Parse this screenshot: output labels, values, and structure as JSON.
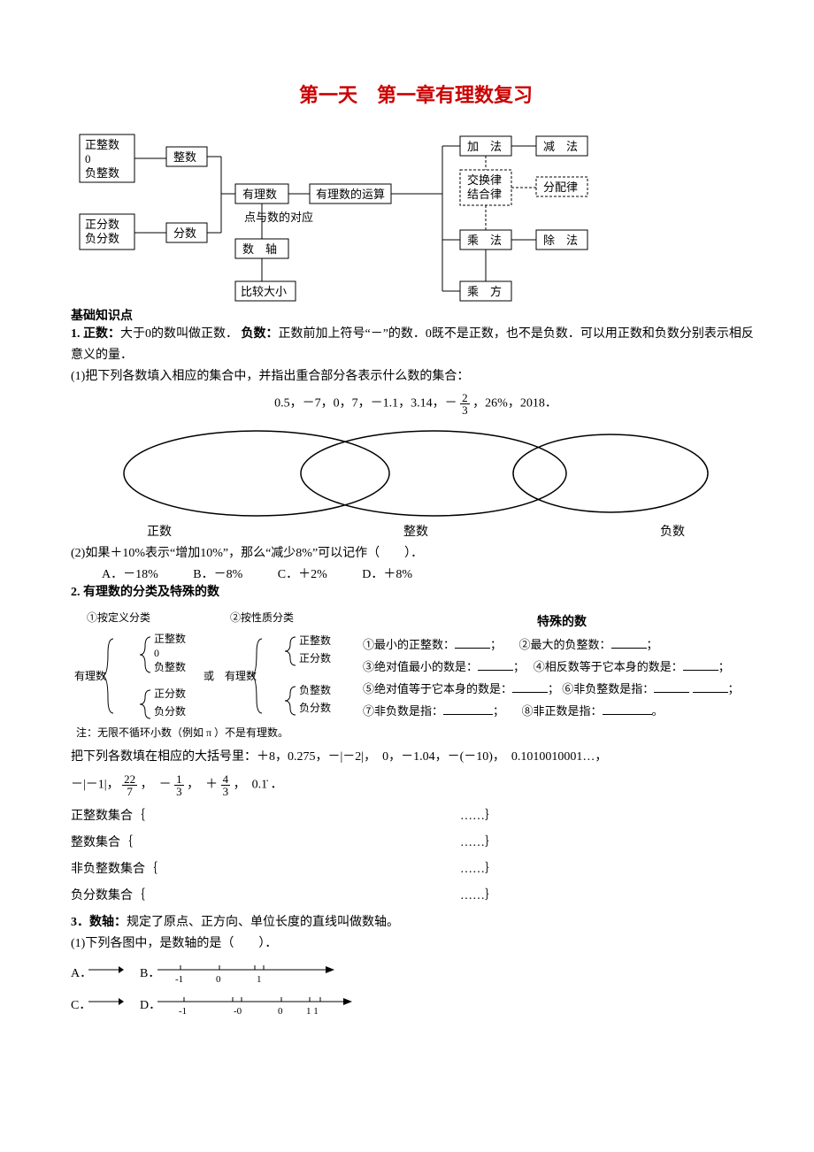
{
  "title": "第一天　第一章有理数复习",
  "diagram": {
    "left": {
      "box1": "正整数\n0\n负整数",
      "box2": "整数",
      "box3": "正分数\n负分数",
      "box4": "分数",
      "box5": "有理数",
      "box6": "有理数的运算",
      "box7": "点与数的对应",
      "box8": "数　轴",
      "box9": "比较大小"
    },
    "right": {
      "add": "加　法",
      "sub": "减　法",
      "laws1": "交换律\n结合律",
      "laws2": "分配律",
      "mul": "乘　法",
      "div": "除　法",
      "pow": "乘　方"
    }
  },
  "section_heading": "基础知识点",
  "p1_bold_a": "1. 正数：",
  "p1_text_a": "大于0的数叫做正数．",
  "p1_bold_b": "负数：",
  "p1_text_b": "正数前加上符号“－”的数．0既不是正数，也不是负数．可以用正数和负数分别表示相反意义的量．",
  "q1": "(1)把下列各数填入相应的集合中，并指出重合部分各表示什么数的集合：",
  "numbers_1": "0.5，－7，0，7，－1.1，3.14，－",
  "numbers_2": "，26%，2018．",
  "frac1_num": "2",
  "frac1_den": "3",
  "venn": {
    "l1": "正数",
    "l2": "整数",
    "l3": "负数"
  },
  "q2": "(2)如果＋10%表示“增加10%”，那么“减少8%”可以记作（　　）．",
  "q2_opts": {
    "a": "A．－18%",
    "b": "B．－8%",
    "c": "C．＋2%",
    "d": "D．＋8%"
  },
  "p2_heading": "2. 有理数的分类及特殊的数",
  "classify": {
    "left_t1": "①按定义分类",
    "left_t2": "②按性质分类",
    "root": "有理数",
    "a1": "正整数",
    "a2": "0",
    "a3": "负整数",
    "a4": "正分数",
    "a5": "负分数",
    "b1": "正整数",
    "b2": "正分数",
    "b3": "负整数",
    "b4": "负分数",
    "or": "或",
    "note": "注：无限不循环小数（例如 π ）不是有理数。"
  },
  "special": {
    "heading": "特殊的数",
    "l1a": "①最小的正整数：",
    "l1b": "②最大的负整数：",
    "l2a": "③绝对值最小的数是：",
    "l2b": "④相反数等于它本身的数是：",
    "l3a": "⑤绝对值等于它本身的数是：",
    "l3b": "⑥非负整数是指：",
    "l4a": "⑦非负数是指：",
    "l4b": "⑧非正数是指：",
    "semi": "；",
    "period": "。"
  },
  "q3_intro": "把下列各数填在相应的大括号里：＋8，0.275，－|－2|，　0，－1.04，－(－10)，　0.1010010001…，",
  "q3_line2_a": "－|－1|，",
  "q3_frac_a_num": "22",
  "q3_frac_a_den": "7",
  "q3_line2_b": "，　－",
  "q3_frac_b_num": "1",
  "q3_frac_b_den": "3",
  "q3_line2_c": "，　＋",
  "q3_frac_c_num": "4",
  "q3_frac_c_den": "3",
  "q3_line2_d": "，　0.1̇ ．",
  "sets": {
    "s1": "正整数集合｛",
    "s2": "整数集合｛",
    "s3": "非负整数集合｛",
    "s4": "负分数集合｛",
    "dots": "……｝"
  },
  "p3_heading": "3．数轴：",
  "p3_text": "规定了原点、正方向、单位长度的直线叫做数轴。",
  "q_nl": "(1)下列各图中，是数轴的是（　　）．",
  "nl_opts": {
    "a": "A．",
    "b": "B．",
    "c": "C．",
    "d": "D．"
  },
  "nl_labels": {
    "m1": "-1",
    "z": "0",
    "p1": "1",
    "p11": "1 1"
  }
}
